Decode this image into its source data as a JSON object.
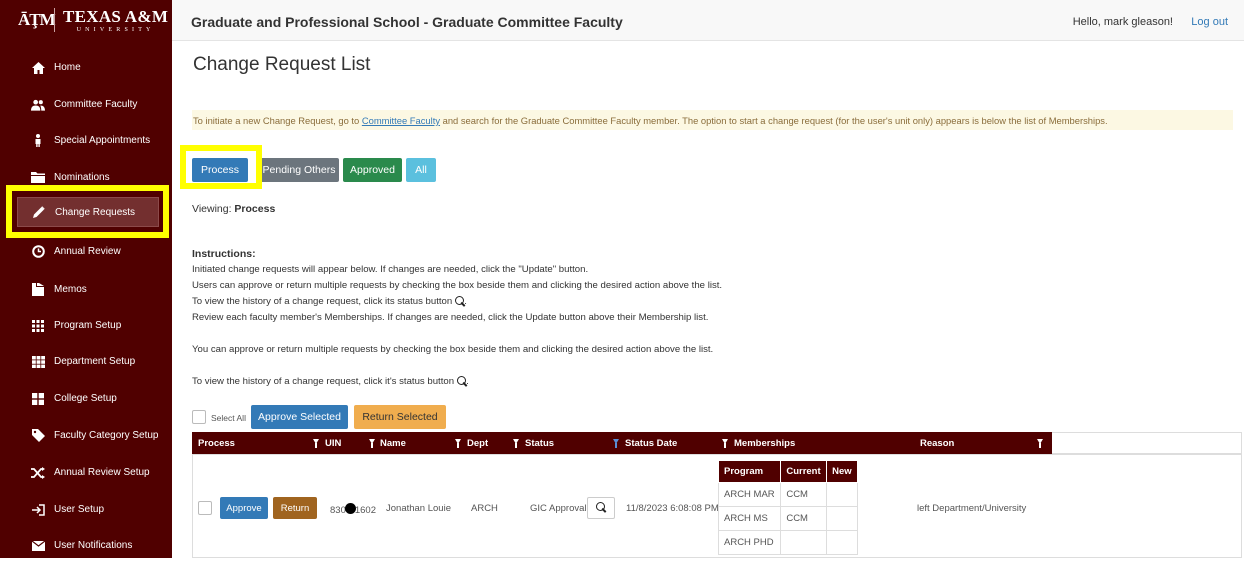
{
  "logo": {
    "mark": "ĀŢM",
    "word_top": "TEXAS A&M",
    "word_bottom": "UNIVERSITY"
  },
  "sidebar": {
    "items": [
      {
        "label": "Home",
        "icon": "home-icon"
      },
      {
        "label": "Committee Faculty",
        "icon": "users-icon"
      },
      {
        "label": "Special Appointments",
        "icon": "person-icon"
      },
      {
        "label": "Nominations",
        "icon": "folder-icon"
      },
      {
        "label": "Change Requests",
        "icon": "pencil-icon"
      },
      {
        "label": "Annual Review",
        "icon": "clock-icon"
      },
      {
        "label": "Memos",
        "icon": "document-icon"
      },
      {
        "label": "Program Setup",
        "icon": "grid-small-icon"
      },
      {
        "label": "Department Setup",
        "icon": "grid-medium-icon"
      },
      {
        "label": "College Setup",
        "icon": "grid-large-icon"
      },
      {
        "label": "Faculty Category Setup",
        "icon": "tag-icon"
      },
      {
        "label": "Annual Review Setup",
        "icon": "shuffle-icon"
      },
      {
        "label": "User Setup",
        "icon": "login-icon"
      },
      {
        "label": "User Notifications",
        "icon": "envelope-icon"
      }
    ]
  },
  "header": {
    "title": "Graduate and Professional School - Graduate Committee Faculty",
    "greeting": "Hello, mark gleason!",
    "logout": "Log out"
  },
  "page": {
    "title": "Change Request List",
    "banner_pre": "To initiate a new Change Request, go to ",
    "banner_link": "Committee Faculty",
    "banner_post": " and search for the Graduate Committee Faculty member. The option to start a change request (for the user's unit only) appears is below the list of Memberships.",
    "filters": [
      "Process",
      "Pending Others",
      "Approved",
      "All"
    ],
    "viewing_label": "Viewing:",
    "viewing_value": "Process",
    "instructions_title": "Instructions:",
    "instructions": [
      "Initiated change requests will appear below. If changes are needed, click the \"Update\" button.",
      "Users can approve or return multiple requests by checking the box beside them and clicking the desired action above the list.",
      "To view the history of a change request, click its status button",
      "Review each faculty member's Memberships. If changes are needed, click the Update button above their Membership list."
    ],
    "note1": "You can approve or return multiple requests by checking the box beside them and clicking the desired action above the list.",
    "note2": "To view the history of a change request, click it's status button",
    "select_all": "Select All",
    "approve_selected": "Approve Selected",
    "return_selected": "Return Selected"
  },
  "table": {
    "columns": [
      "Process",
      "UIN",
      "Name",
      "Dept",
      "Status",
      "Status Date",
      "Memberships",
      "Reason"
    ],
    "rows": [
      {
        "approve": "Approve",
        "return": "Return",
        "uin_start": "830",
        "uin_end": "1602",
        "name": "Jonathan Louie",
        "dept": "ARCH",
        "status": "GIC Approval",
        "status_date": "11/8/2023 6:08:08 PM",
        "reason": "left Department/University",
        "memberships": {
          "headers": [
            "Program",
            "Current",
            "New"
          ],
          "rows": [
            [
              "ARCH MAR",
              "CCM",
              ""
            ],
            [
              "ARCH MS",
              "CCM",
              ""
            ],
            [
              "ARCH PHD",
              "",
              ""
            ]
          ]
        }
      }
    ]
  },
  "colors": {
    "maroon": "#500000",
    "highlight": "#ffff00",
    "primary": "#337ab7",
    "success": "#2a8a4c",
    "info": "#5bc0de",
    "warning": "#f0ad4e",
    "return_btn": "#a0641f"
  }
}
